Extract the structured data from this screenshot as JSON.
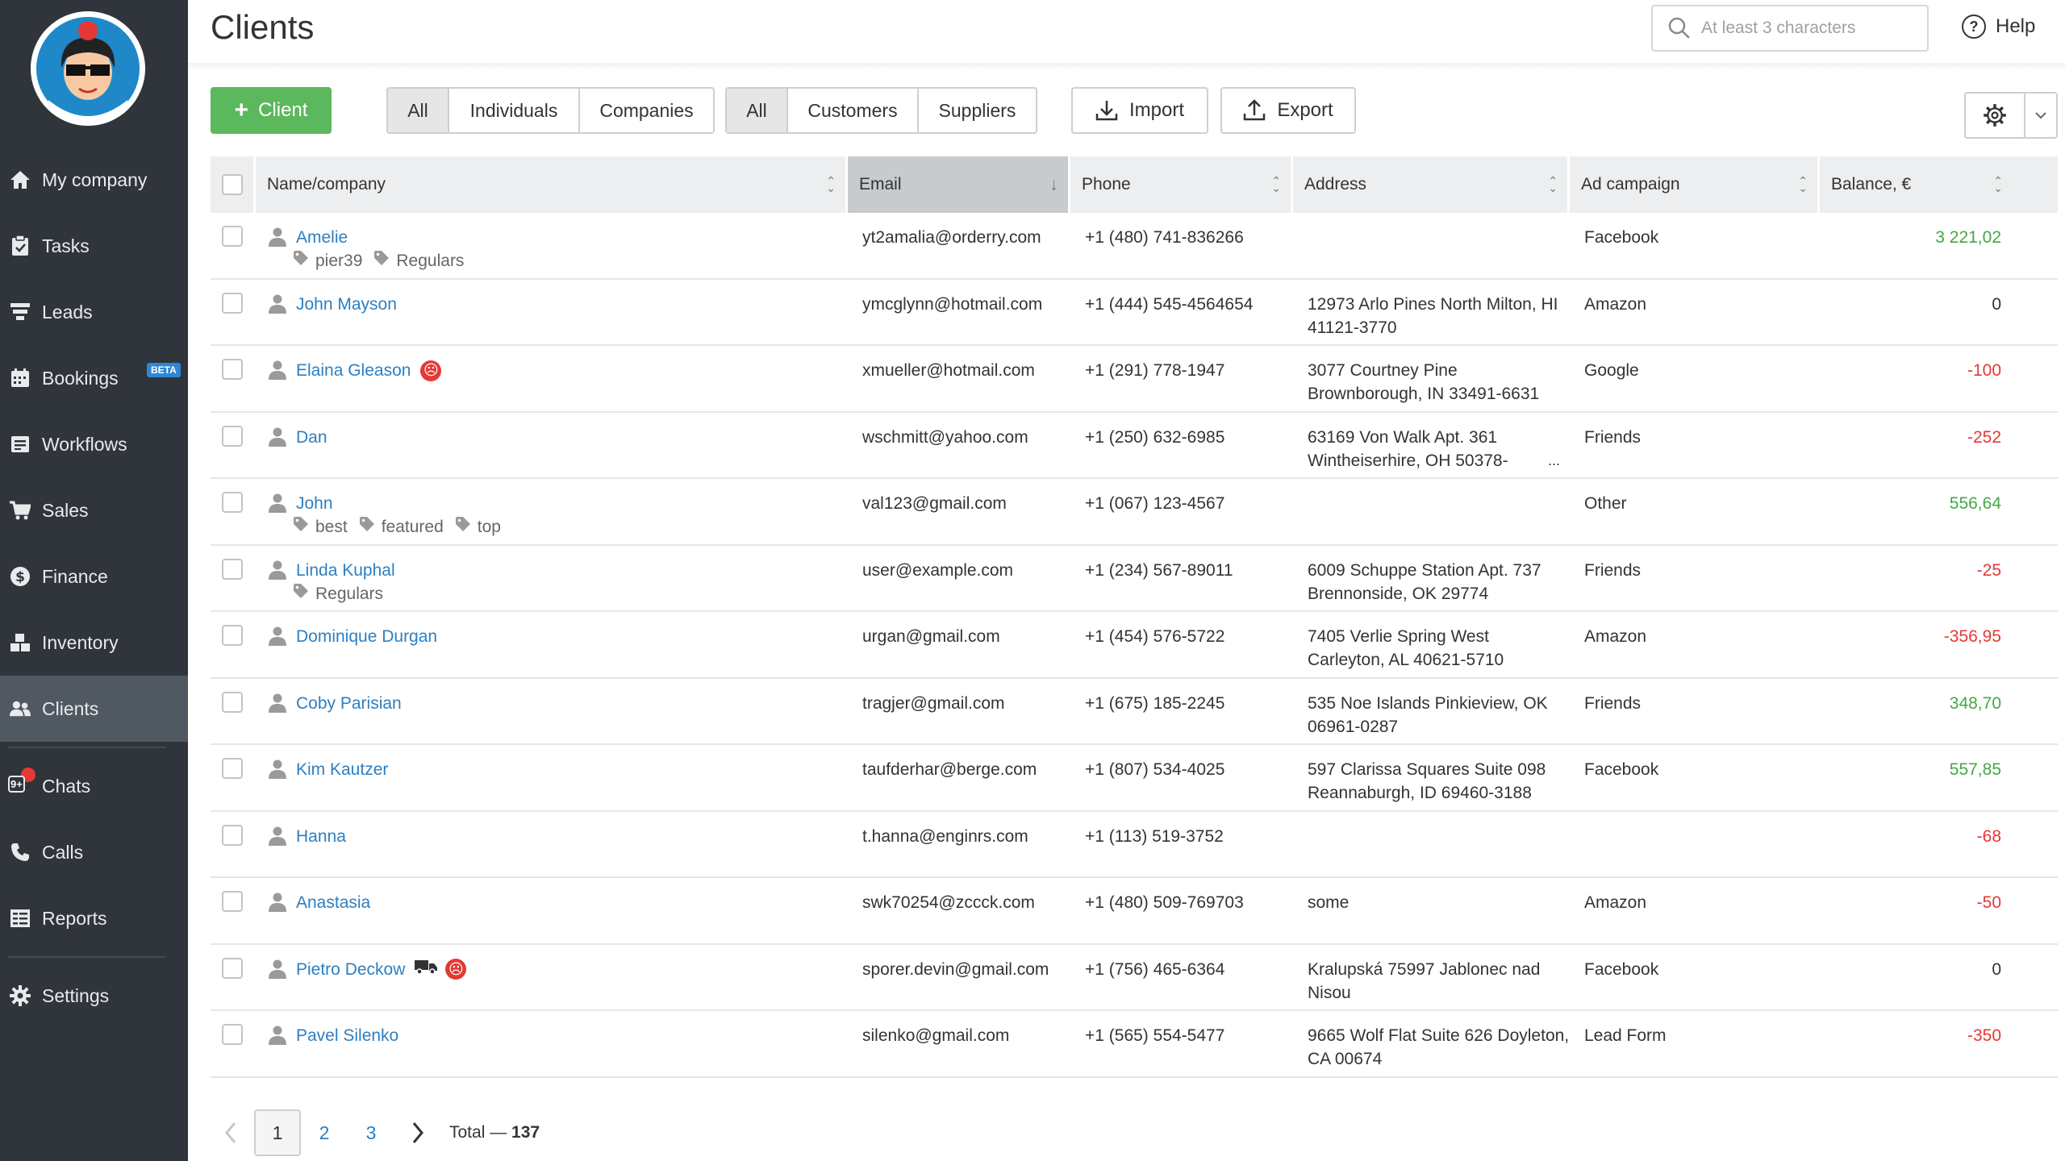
{
  "page": {
    "title": "Clients"
  },
  "search": {
    "placeholder": "At least 3 characters"
  },
  "help": {
    "label": "Help"
  },
  "sidebar": {
    "items": [
      {
        "label": "My company",
        "icon": "home-icon"
      },
      {
        "label": "Tasks",
        "icon": "clipboard-check-icon"
      },
      {
        "label": "Leads",
        "icon": "funnel-icon"
      },
      {
        "label": "Bookings",
        "icon": "calendar-icon",
        "badge": "BETA"
      },
      {
        "label": "Workflows",
        "icon": "workflow-icon"
      },
      {
        "label": "Sales",
        "icon": "cart-icon"
      },
      {
        "label": "Finance",
        "icon": "dollar-icon"
      },
      {
        "label": "Inventory",
        "icon": "boxes-icon"
      },
      {
        "label": "Clients",
        "icon": "users-icon",
        "active": true
      },
      {
        "label": "Chats",
        "icon": "chat-icon",
        "badge": "9+"
      },
      {
        "label": "Calls",
        "icon": "phone-icon"
      },
      {
        "label": "Reports",
        "icon": "reports-icon"
      },
      {
        "label": "Settings",
        "icon": "gear-icon"
      }
    ]
  },
  "toolbar": {
    "add_client_label": "Client",
    "type_filter": {
      "options": [
        "All",
        "Individuals",
        "Companies"
      ],
      "selected": "All"
    },
    "role_filter": {
      "options": [
        "All",
        "Customers",
        "Suppliers"
      ],
      "selected": "All"
    },
    "import_label": "Import",
    "export_label": "Export"
  },
  "table": {
    "columns": [
      "Name/company",
      "Email",
      "Phone",
      "Address",
      "Ad campaign",
      "Balance, €"
    ],
    "sorted_column": "Email",
    "rows": [
      {
        "name": "Amelie",
        "tags": [
          "pier39",
          "Regulars"
        ],
        "email": "yt2amalia@orderry.com",
        "phone": "+1 (480) 741-836266",
        "address": "",
        "ad": "Facebook",
        "balance": "3 221,02",
        "sign": "pos"
      },
      {
        "name": "John Mayson",
        "tags": [],
        "email": "ymcglynn@hotmail.com",
        "phone": "+1 (444) 545-4564654",
        "address": "12973 Arlo Pines North Milton, HI 41121-3770",
        "ad": "Amazon",
        "balance": "0",
        "sign": "zero"
      },
      {
        "name": "Elaina Gleason",
        "tags": [],
        "sad": true,
        "email": "xmueller@hotmail.com",
        "phone": "+1 (291) 778-1947",
        "address": "3077 Courtney Pine Brownborough, IN 33491-6631",
        "ad": "Google",
        "balance": "-100",
        "sign": "neg"
      },
      {
        "name": "Dan",
        "tags": [],
        "email": "wschmitt@yahoo.com",
        "phone": "+1 (250) 632-6985",
        "address": "63169 Von Walk Apt. 361 Wintheiserhire, OH 50378-",
        "address_more": "...",
        "ad": "Friends",
        "balance": "-252",
        "sign": "neg"
      },
      {
        "name": "John",
        "tags": [
          "best",
          "featured",
          "top"
        ],
        "email": "val123@gmail.com",
        "phone": "+1 (067) 123-4567",
        "address": "",
        "ad": "Other",
        "balance": "556,64",
        "sign": "pos"
      },
      {
        "name": "Linda Kuphal",
        "tags": [
          "Regulars"
        ],
        "email": "user@example.com",
        "phone": "+1 (234) 567-89011",
        "address": "6009 Schuppe Station Apt. 737 Brennonside, OK 29774",
        "ad": "Friends",
        "balance": "-25",
        "sign": "neg"
      },
      {
        "name": "Dominique Durgan",
        "tags": [],
        "email": "urgan@gmail.com",
        "phone": "+1 (454) 576-5722",
        "address": "7405 Verlie Spring West Carleyton, AL 40621-5710",
        "ad": "Amazon",
        "balance": "-356,95",
        "sign": "neg"
      },
      {
        "name": "Coby Parisian",
        "tags": [],
        "email": "tragjer@gmail.com",
        "phone": "+1 (675) 185-2245",
        "address": "535 Noe Islands Pinkieview, OK 06961-0287",
        "ad": "Friends",
        "balance": "348,70",
        "sign": "pos"
      },
      {
        "name": "Kim Kautzer",
        "tags": [],
        "email": "taufderhar@berge.com",
        "phone": "+1 (807) 534-4025",
        "address": "597 Clarissa Squares Suite 098 Reannaburgh, ID 69460-3188",
        "ad": "Facebook",
        "balance": "557,85",
        "sign": "pos"
      },
      {
        "name": "Hanna",
        "tags": [],
        "email": "t.hanna@enginrs.com",
        "phone": "+1 (113) 519-3752",
        "address": "",
        "ad": "",
        "balance": "-68",
        "sign": "neg"
      },
      {
        "name": "Anastasia",
        "tags": [],
        "email": "swk70254@zccck.com",
        "phone": "+1 (480) 509-769703",
        "address": "some",
        "ad": "Amazon",
        "balance": "-50",
        "sign": "neg"
      },
      {
        "name": "Pietro Deckow",
        "tags": [],
        "truck": true,
        "sad": true,
        "email": "sporer.devin@gmail.com",
        "phone": "+1 (756) 465-6364",
        "address": "Kralupská 75997 Jablonec nad Nisou",
        "ad": "Facebook",
        "balance": "0",
        "sign": "zero"
      },
      {
        "name": "Pavel Silenko",
        "tags": [],
        "email": "silenko@gmail.com",
        "phone": "+1 (565) 554-5477",
        "address": "9665 Wolf Flat Suite 626 Doyleton, CA 00674",
        "ad": "Lead Form",
        "balance": "-350",
        "sign": "neg"
      }
    ]
  },
  "pagination": {
    "pages": [
      "1",
      "2",
      "3"
    ],
    "current": "1",
    "total_label": "Total — ",
    "total": "137"
  },
  "colors": {
    "sidebar_bg": "#2f353a",
    "accent_green": "#5cb85c",
    "link_blue": "#2d7fc1",
    "negative_red": "#e53935",
    "positive_green": "#43a843"
  }
}
